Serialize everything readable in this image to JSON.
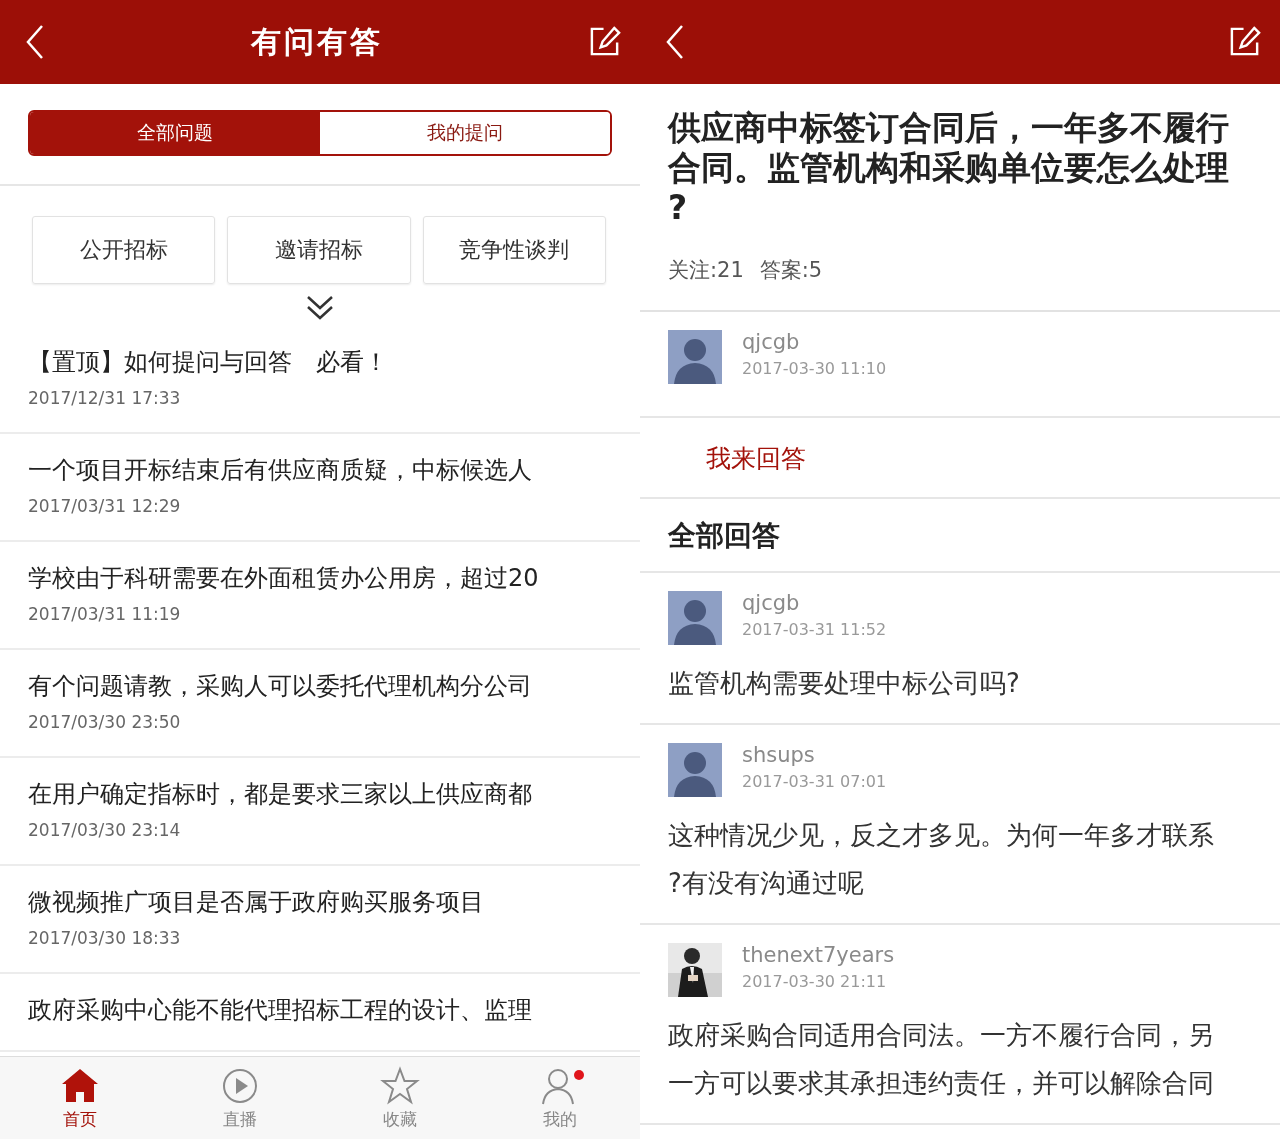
{
  "left_screen": {
    "header": {
      "title": "有问有答"
    },
    "tabs": [
      {
        "label": "全部问题",
        "selected": true
      },
      {
        "label": "我的提问",
        "selected": false
      }
    ],
    "categories": [
      "公开招标",
      "邀请招标",
      "竞争性谈判"
    ],
    "questions": [
      {
        "title": "【置顶】如何提问与回答　必看！",
        "date": "2017/12/31 17:33"
      },
      {
        "title": "一个项目开标结束后有供应商质疑，中标候选人",
        "date": "2017/03/31 12:29"
      },
      {
        "title": "学校由于科研需要在外面租赁办公用房，超过20",
        "date": "2017/03/31 11:19"
      },
      {
        "title": "有个问题请教，采购人可以委托代理机构分公司",
        "date": "2017/03/30 23:50"
      },
      {
        "title": "在用户确定指标时，都是要求三家以上供应商都",
        "date": "2017/03/30 23:14"
      },
      {
        "title": "微视频推广项目是否属于政府购买服务项目",
        "date": "2017/03/30 18:33"
      },
      {
        "title": "政府采购中心能不能代理招标工程的设计、监理"
      }
    ],
    "tab_bar": [
      {
        "label": "首页",
        "selected": true,
        "badge": false
      },
      {
        "label": "直播",
        "selected": false,
        "badge": false
      },
      {
        "label": "收藏",
        "selected": false,
        "badge": false
      },
      {
        "label": "我的",
        "selected": false,
        "badge": true
      }
    ]
  },
  "right_screen": {
    "question": {
      "title": "供应商中标签订合同后，一年多不履行合同。监管机构和采购单位要怎么处理?",
      "follows": "关注:21",
      "answers_count": "答案:5",
      "asker": {
        "name": "qjcgb",
        "time": "2017-03-30 11:10",
        "kind": "default"
      }
    },
    "answer_button": "我来回答",
    "section_title": "全部回答",
    "answers": [
      {
        "name": "qjcgb",
        "time": "2017-03-31 11:52",
        "kind": "default",
        "text": "监管机构需要处理中标公司吗?"
      },
      {
        "name": "shsups",
        "time": "2017-03-31 07:01",
        "kind": "default",
        "text": "这种情况少见，反之才多见。为何一年多才联系?有没有沟通过呢"
      },
      {
        "name": "thenext7years",
        "time": "2017-03-30 21:11",
        "kind": "picture",
        "text": "政府采购合同适用合同法。一方不履行合同，另一方可以要求其承担违约责任，并可以解除合同"
      }
    ]
  }
}
